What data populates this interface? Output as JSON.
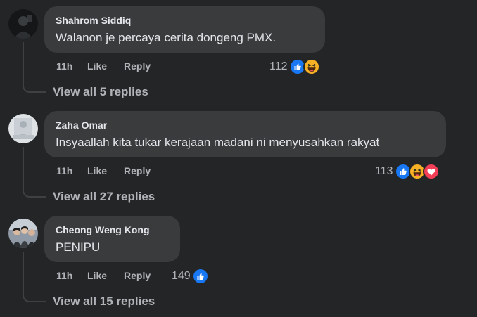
{
  "comments": [
    {
      "author": "Shahrom Siddiq",
      "text": "Walanon je percaya cerita dongeng PMX.",
      "time": "11h",
      "like_label": "Like",
      "reply_label": "Reply",
      "reaction_count": "112",
      "reactions": [
        "like-icon",
        "haha-icon"
      ],
      "view_replies": "View all 5 replies"
    },
    {
      "author": "Zaha Omar",
      "text": "Insyaallah kita tukar kerajaan madani ni menyusahkan rakyat",
      "time": "11h",
      "like_label": "Like",
      "reply_label": "Reply",
      "reaction_count": "113",
      "reactions": [
        "like-icon",
        "haha-icon",
        "love-icon"
      ],
      "view_replies": "View all 27 replies"
    },
    {
      "author": "Cheong Weng Kong",
      "text": "PENIPU",
      "time": "11h",
      "like_label": "Like",
      "reply_label": "Reply",
      "reaction_count": "149",
      "reactions": [
        "like-icon"
      ],
      "view_replies": "View all 15 replies"
    }
  ],
  "colors": {
    "background": "#242526",
    "bubble": "#3a3b3c",
    "primary_text": "#e4e6eb",
    "secondary_text": "#b0b3b8",
    "like_blue": "#1877f2",
    "love_red": "#f33e58",
    "haha_yellow": "#f7b125"
  }
}
